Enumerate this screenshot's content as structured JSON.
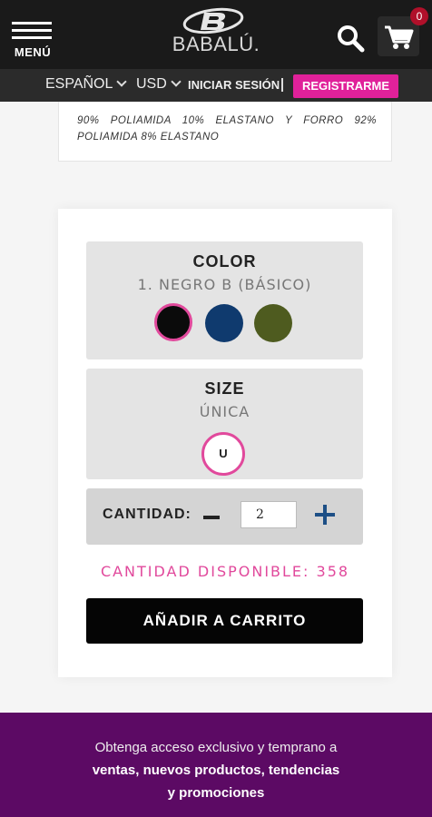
{
  "header": {
    "menu_label": "MENÚ",
    "logo_text": "BABALÚ.",
    "cart_count": "0",
    "icons": [
      "menu-icon",
      "search-icon",
      "cart-icon"
    ]
  },
  "subnav": {
    "language": "ESPAÑOL",
    "currency": "USD",
    "login": "INICIAR SESIÓN",
    "register": "REGISTRARME"
  },
  "description": {
    "text": "90% POLIAMIDA 10% ELASTANO Y FORRO 92% POLIAMIDA 8% ELASTANO"
  },
  "product_options": {
    "color": {
      "title": "COLOR",
      "selected": "1. NEGRO B (BÁSICO)",
      "swatches": [
        {
          "name": "black",
          "hex": "#0b0b0b",
          "selected": true
        },
        {
          "name": "navy",
          "hex": "#0f3a6e",
          "selected": false
        },
        {
          "name": "olive",
          "hex": "#4e5b1f",
          "selected": false
        }
      ]
    },
    "size": {
      "title": "SIZE",
      "selected": "ÚNICA",
      "options": [
        "U"
      ]
    },
    "quantity": {
      "label": "CANTIDAD:",
      "value": "2"
    },
    "available": "CANTIDAD DISPONIBLE: 358",
    "add_to_cart": "AÑADIR A CARRITO"
  },
  "promo": {
    "line1": "Obtenga acceso exclusivo y temprano a",
    "line2": "ventas, nuevos productos, tendencias",
    "line3": "y promociones"
  },
  "colors": {
    "header_bg": "#1a1a1a",
    "accent_pink": "#e0219a",
    "promo_bg": "#5c0a64",
    "button_bg": "#050505"
  }
}
